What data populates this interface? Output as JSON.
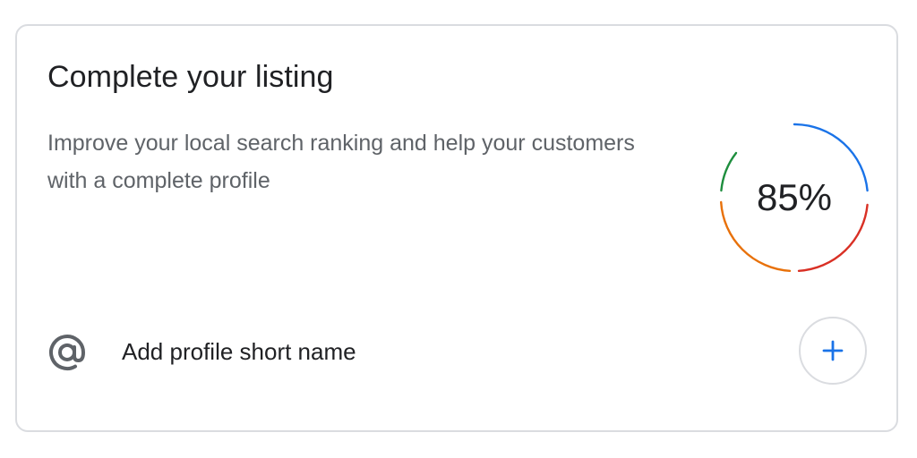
{
  "card": {
    "title": "Complete your listing",
    "description": "Improve your local search ranking and help your customers with a complete profile"
  },
  "progress": {
    "label": "85%",
    "value": 0.85,
    "colors": {
      "blue": "#1a73e8",
      "red": "#d93025",
      "orange": "#e8710a",
      "green": "#1e8e3e"
    }
  },
  "task": {
    "icon": "at-sign-icon",
    "label": "Add profile short name",
    "action_icon": "plus-icon"
  }
}
